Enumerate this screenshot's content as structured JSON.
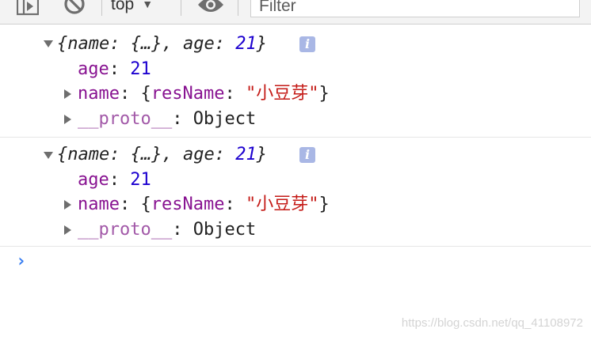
{
  "toolbar": {
    "context": "top",
    "filter_placeholder": "Filter",
    "icons": [
      "sidebar-toggle-icon",
      "clear-console-icon",
      "chevron-down-icon",
      "eye-icon"
    ]
  },
  "entries": [
    {
      "summary": {
        "open": "{",
        "k1": "name",
        "v1": "{…}",
        "k2": "age",
        "v2": "21",
        "close": "}"
      },
      "info_icon_glyph": "i",
      "age": {
        "key": "age",
        "value": "21"
      },
      "name": {
        "key": "name",
        "inner_key": "resName",
        "inner_value": "\"小豆芽\""
      },
      "proto": {
        "key": "__proto__",
        "value": "Object"
      }
    },
    {
      "summary": {
        "open": "{",
        "k1": "name",
        "v1": "{…}",
        "k2": "age",
        "v2": "21",
        "close": "}"
      },
      "info_icon_glyph": "i",
      "age": {
        "key": "age",
        "value": "21"
      },
      "name": {
        "key": "name",
        "inner_key": "resName",
        "inner_value": "\"小豆芽\""
      },
      "proto": {
        "key": "__proto__",
        "value": "Object"
      }
    }
  ],
  "prompt_symbol": "›",
  "watermark": "https://blog.csdn.net/qq_41108972",
  "colors": {
    "number": "#1c00cf",
    "key": "#881391",
    "string": "#c41a16",
    "proto": "#a259a8",
    "prompt": "#367cf1",
    "info_badge": "#a9b7e5"
  }
}
